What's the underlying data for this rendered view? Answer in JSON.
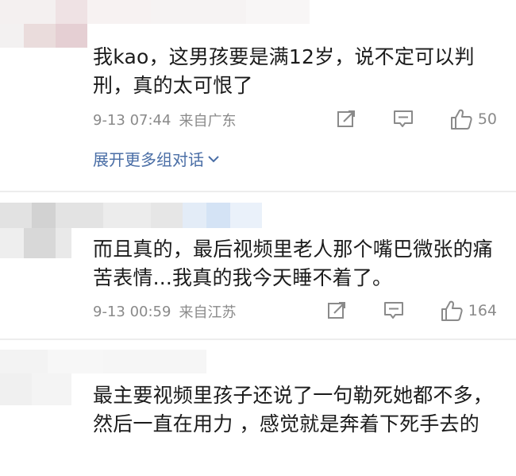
{
  "comments": [
    {
      "text": "我kao，这男孩要是满12岁，说不定可以判刑，真的太可恨了",
      "time": "9-13 07:44",
      "source": "来自广东",
      "likes": "50",
      "expand_label": "展开更多组对话"
    },
    {
      "text": "而且真的，最后视频里老人那个嘴巴微张的痛苦表情...我真的我今天睡不着了。",
      "time": "9-13 00:59",
      "source": "来自江苏",
      "likes": "164"
    },
    {
      "text": "最主要视频里孩子还说了一句勒死她都不多，然后一直在用力 ，感觉就是奔着下死手去的"
    }
  ],
  "colors": {
    "link": "#4a6ea6",
    "meta": "#8a8a8a",
    "text": "#1b1b1b"
  },
  "icons": [
    "repost-icon",
    "comment-icon",
    "like-icon",
    "chevron-down-icon"
  ]
}
